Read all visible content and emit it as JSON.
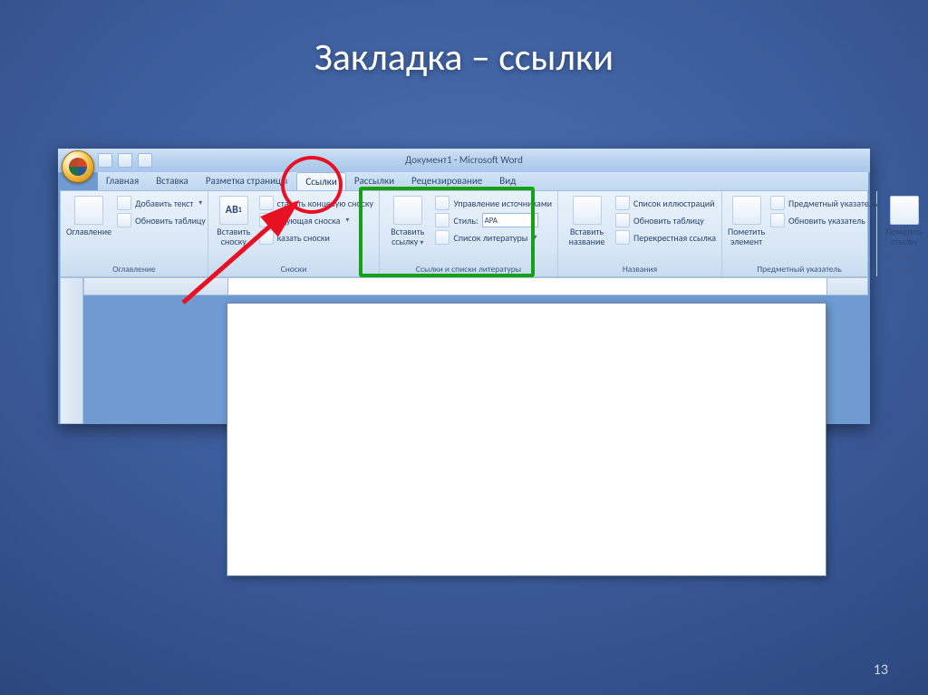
{
  "slide": {
    "title": "Закладка – ссылки",
    "page_number": "13"
  },
  "word": {
    "doc_title": "Документ1 - Microsoft Word",
    "qat": {
      "save": "save",
      "undo": "undo",
      "redo": "redo"
    },
    "tabs": {
      "home": "Главная",
      "insert": "Вставка",
      "page_layout": "Разметка страницы",
      "references": "Ссылки",
      "mailings": "Рассылки",
      "review": "Рецензирование",
      "view": "Вид"
    },
    "ribbon": {
      "toc": {
        "label": "Оглавление",
        "toc_btn": "Оглавление",
        "add_text": "Добавить текст",
        "update_table": "Обновить таблицу"
      },
      "footnotes": {
        "label": "Сноски",
        "insert_footnote": "Вставить сноску",
        "insert_endnote": "ставить концевую сноску",
        "next_footnote": "едующая сноска",
        "show_notes": "казать сноски",
        "ab_label": "AB"
      },
      "citations": {
        "label": "Ссылки и списки литературы",
        "insert_citation": "Вставить ссылку",
        "manage_sources": "Управление источниками",
        "style_label": "Стиль:",
        "style_value": "APA",
        "bibliography": "Список литературы"
      },
      "captions": {
        "label": "Названия",
        "insert_caption": "Вставить название",
        "figures_list": "Список иллюстраций",
        "update_table": "Обновить таблицу",
        "cross_ref": "Перекрестная ссылка"
      },
      "index": {
        "label": "Предметный указатель",
        "mark_entry": "Пометить элемент",
        "insert_index": "Предметный указатель",
        "update_index": "Обновить указатель"
      },
      "authorities": {
        "label": "Таблица ссылок",
        "mark_citation": "Пометить ссылку"
      }
    },
    "corner_marker": "L"
  },
  "annotations": {
    "red_circle": "highlight-references-tab",
    "green_box": "highlight-citations-group",
    "red_arrow": "arrow-to-tab"
  }
}
